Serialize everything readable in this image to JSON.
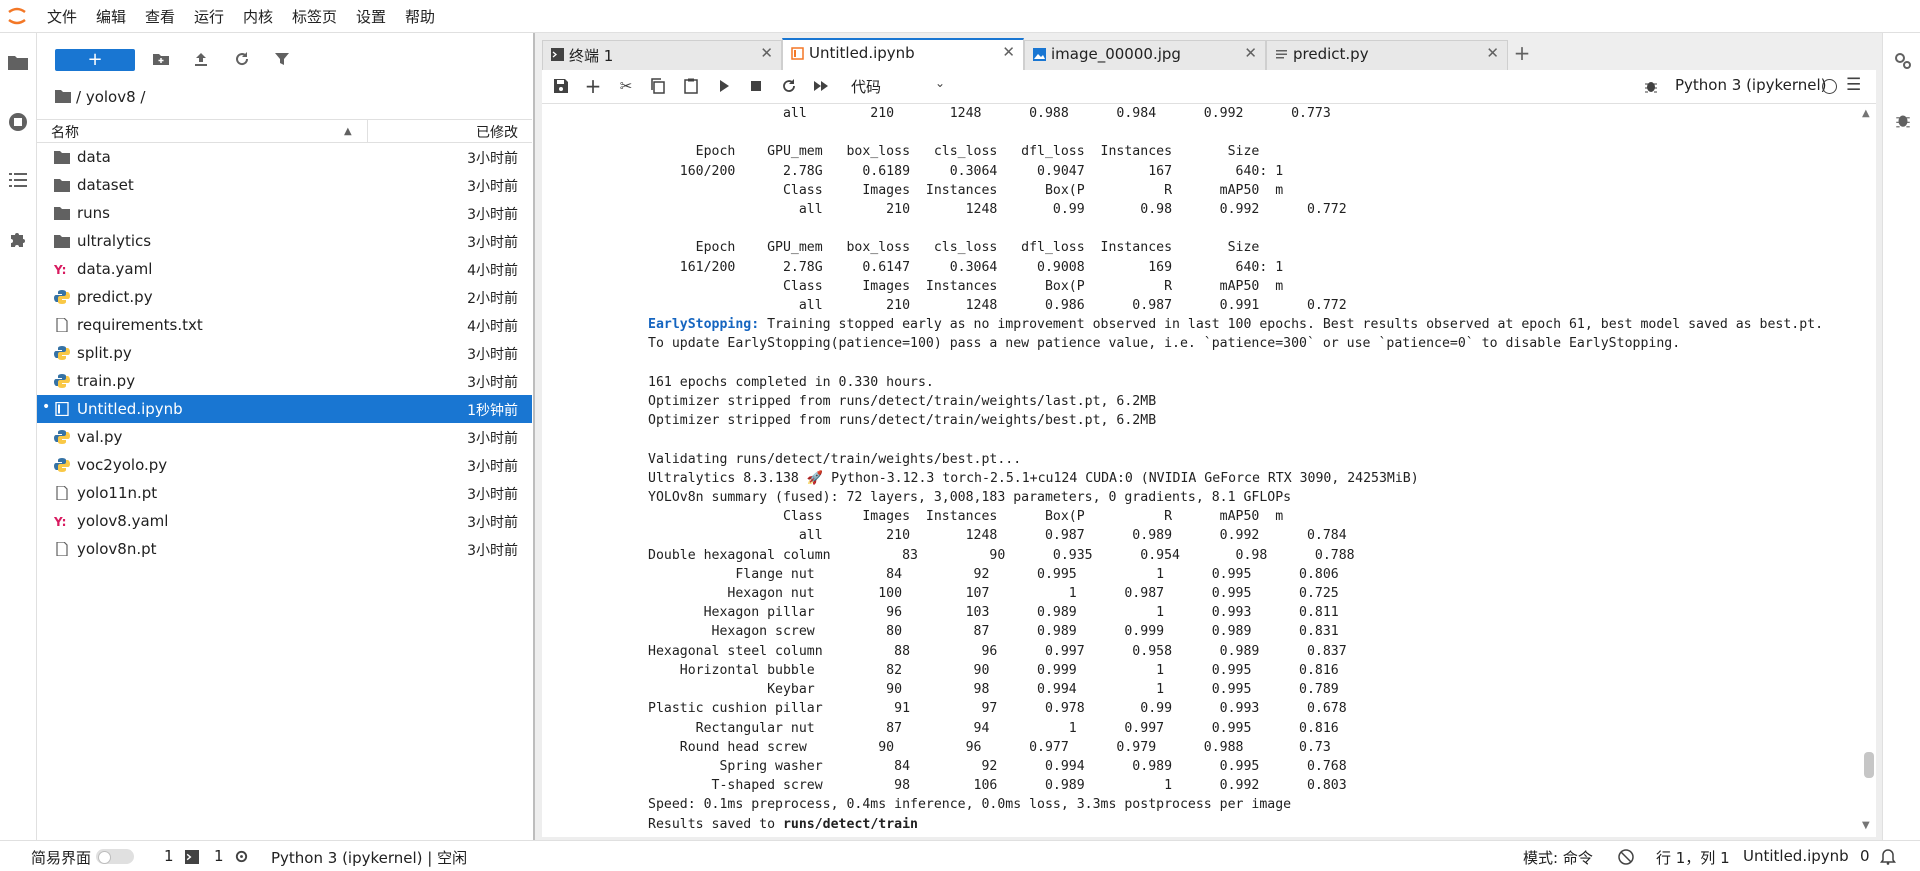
{
  "menu": {
    "items": [
      "文件",
      "编辑",
      "查看",
      "运行",
      "内核",
      "标签页",
      "设置",
      "帮助"
    ]
  },
  "sidebar_icons": [
    "folder-icon",
    "running-icon",
    "toc-icon",
    "extension-icon"
  ],
  "filebrowser": {
    "new_label": "+",
    "breadcrumb": "/ yolov8 /",
    "col_name": "名称",
    "col_modified": "已修改",
    "files": [
      {
        "name": "data",
        "time": "3小时前",
        "type": "folder"
      },
      {
        "name": "dataset",
        "time": "3小时前",
        "type": "folder"
      },
      {
        "name": "runs",
        "time": "3小时前",
        "type": "folder"
      },
      {
        "name": "ultralytics",
        "time": "3小时前",
        "type": "folder"
      },
      {
        "name": "data.yaml",
        "time": "4小时前",
        "type": "yaml"
      },
      {
        "name": "predict.py",
        "time": "2小时前",
        "type": "python"
      },
      {
        "name": "requirements.txt",
        "time": "4小时前",
        "type": "file"
      },
      {
        "name": "split.py",
        "time": "3小时前",
        "type": "python"
      },
      {
        "name": "train.py",
        "time": "3小时前",
        "type": "python"
      },
      {
        "name": "Untitled.ipynb",
        "time": "1秒钟前",
        "type": "notebook",
        "selected": true
      },
      {
        "name": "val.py",
        "time": "3小时前",
        "type": "python"
      },
      {
        "name": "voc2yolo.py",
        "time": "3小时前",
        "type": "python"
      },
      {
        "name": "yolo11n.pt",
        "time": "3小时前",
        "type": "file"
      },
      {
        "name": "yolov8.yaml",
        "time": "3小时前",
        "type": "yaml"
      },
      {
        "name": "yolov8n.pt",
        "time": "3小时前",
        "type": "file"
      }
    ]
  },
  "tabs": [
    {
      "label": "终端 1",
      "icon": "terminal-icon",
      "active": false
    },
    {
      "label": "Untitled.ipynb",
      "icon": "notebook-icon",
      "active": true
    },
    {
      "label": "image_00000.jpg",
      "icon": "image-icon",
      "active": false
    },
    {
      "label": "predict.py",
      "icon": "text-file-icon",
      "active": false
    }
  ],
  "notebook_toolbar": {
    "cell_type": "代码",
    "kernel": "Python 3 (ipykernel)"
  },
  "output": {
    "lines_pre": [
      "                 all        210       1248      0.988      0.984      0.992      0.773",
      "",
      "      Epoch    GPU_mem   box_loss   cls_loss   dfl_loss  Instances       Size",
      "    160/200      2.78G     0.6189     0.3064     0.9047        167        640: 1",
      "                 Class     Images  Instances      Box(P          R      mAP50  m",
      "                   all        210       1248       0.99       0.98      0.992      0.772",
      "",
      "      Epoch    GPU_mem   box_loss   cls_loss   dfl_loss  Instances       Size",
      "    161/200      2.78G     0.6147     0.3064     0.9008        169        640: 1",
      "                 Class     Images  Instances      Box(P          R      mAP50  m",
      "                   all        210       1248      0.986      0.987      0.991      0.772"
    ],
    "early_label": "EarlyStopping:",
    "early_text": " Training stopped early as no improvement observed in last 100 epochs. Best results observed at epoch 61, best model saved as best.pt.",
    "lines_post": [
      "To update EarlyStopping(patience=100) pass a new patience value, i.e. `patience=300` or use `patience=0` to disable EarlyStopping.",
      "",
      "161 epochs completed in 0.330 hours.",
      "Optimizer stripped from runs/detect/train/weights/last.pt, 6.2MB",
      "Optimizer stripped from runs/detect/train/weights/best.pt, 6.2MB",
      "",
      "Validating runs/detect/train/weights/best.pt...",
      "Ultralytics 8.3.138 🚀 Python-3.12.3 torch-2.5.1+cu124 CUDA:0 (NVIDIA GeForce RTX 3090, 24253MiB)",
      "YOLOv8n summary (fused): 72 layers, 3,008,183 parameters, 0 gradients, 8.1 GFLOPs",
      "                 Class     Images  Instances      Box(P          R      mAP50  m",
      "                   all        210       1248      0.987      0.989      0.992      0.784",
      "Double hexagonal column         83         90      0.935      0.954       0.98      0.788",
      "           Flange nut         84         92      0.995          1      0.995      0.806",
      "          Hexagon nut        100        107          1      0.987      0.995      0.725",
      "       Hexagon pillar         96        103      0.989          1      0.993      0.811",
      "        Hexagon screw         80         87      0.989      0.999      0.989      0.831",
      "Hexagonal steel column         88         96      0.997      0.958      0.989      0.837",
      "    Horizontal bubble         82         90      0.999          1      0.995      0.816",
      "               Keybar         90         98      0.994          1      0.995      0.789",
      "Plastic cushion pillar         91         97      0.978       0.99      0.993      0.678",
      "      Rectangular nut         87         94          1      0.997      0.995      0.816",
      "    Round head screw         90         96      0.977      0.979      0.988       0.73",
      "         Spring washer         84         92      0.994      0.989      0.995      0.768",
      "        T-shaped screw         98        106      0.989          1      0.992      0.803",
      "Speed: 0.1ms preprocess, 0.4ms inference, 0.0ms loss, 3.3ms postprocess per image"
    ],
    "results_label": "Results saved to ",
    "results_path": "runs/detect/train"
  },
  "status": {
    "simple_label": "简易界面",
    "count1": "1",
    "count2": "1",
    "kernel_status": "Python 3 (ipykernel) | 空闲",
    "mode": "模式: 命令",
    "position": "行 1，列 1",
    "filename": "Untitled.ipynb",
    "notifications": "0"
  }
}
